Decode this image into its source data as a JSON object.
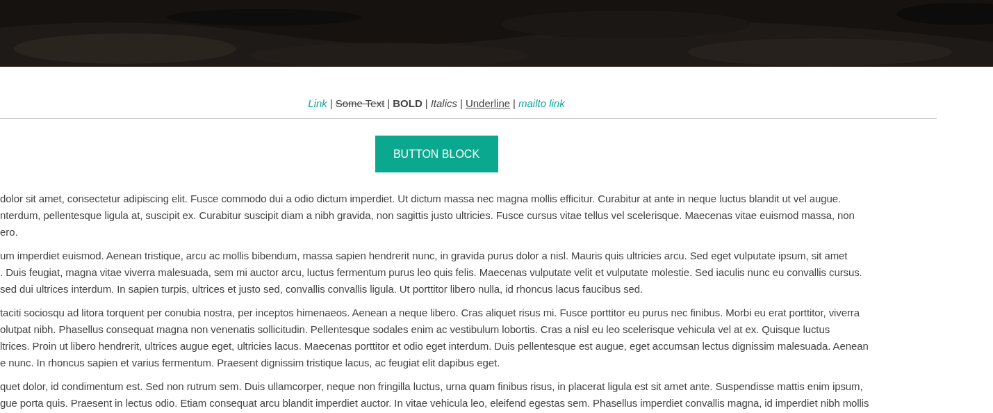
{
  "format_line": [
    {
      "kind": "link",
      "text": "Link"
    },
    {
      "kind": "separator",
      "text": "|"
    },
    {
      "kind": "strike",
      "text": "Some Text"
    },
    {
      "kind": "separator",
      "text": "|"
    },
    {
      "kind": "bold",
      "text": "BOLD"
    },
    {
      "kind": "separator",
      "text": "|"
    },
    {
      "kind": "italic",
      "text": "Italics"
    },
    {
      "kind": "separator",
      "text": "|"
    },
    {
      "kind": "underline",
      "text": "Underline"
    },
    {
      "kind": "separator",
      "text": "|"
    },
    {
      "kind": "link",
      "text": "mailto link"
    }
  ],
  "button": {
    "label": "BUTTON BLOCK"
  },
  "paragraphs": [
    {
      "lines": [
        "dolor sit amet, consectetur adipiscing elit. Fusce commodo dui a odio dictum imperdiet. Ut dictum massa nec magna mollis efficitur. Curabitur at ante in neque luctus blandit ut vel augue.",
        "nterdum, pellentesque ligula at, suscipit ex. Curabitur suscipit diam a nibh gravida, non sagittis justo ultricies. Fusce cursus vitae tellus vel scelerisque. Maecenas vitae euismod massa, non",
        "ero."
      ]
    },
    {
      "lines": [
        "um imperdiet euismod. Aenean tristique, arcu ac mollis bibendum, massa sapien hendrerit nunc, in gravida purus dolor a nisl. Mauris quis ultricies arcu. Sed eget vulputate ipsum, sit amet",
        ". Duis feugiat, magna vitae viverra malesuada, sem mi auctor arcu, luctus fermentum purus leo quis felis. Maecenas vulputate velit et vulputate molestie. Sed iaculis nunc eu convallis cursus.",
        "sed dui ultrices interdum. In sapien turpis, ultrices et justo sed, convallis convallis ligula. Ut porttitor libero nulla, id rhoncus lacus faucibus sed."
      ]
    },
    {
      "lines": [
        "taciti sociosqu ad litora torquent per conubia nostra, per inceptos himenaeos. Aenean a neque libero. Cras aliquet risus mi. Fusce porttitor eu purus nec finibus. Morbi eu erat porttitor, viverra",
        "olutpat nibh. Phasellus consequat magna non venenatis sollicitudin. Pellentesque sodales enim ac vestibulum lobortis. Cras a nisl eu leo scelerisque vehicula vel at ex. Quisque luctus",
        "ltrices. Proin ut libero hendrerit, ultrices augue eget, ultricies lacus. Maecenas porttitor et odio eget interdum. Duis pellentesque est augue, eget accumsan lectus dignissim malesuada. Aenean",
        "e nunc. In rhoncus sapien et varius fermentum. Praesent dignissim tristique lacus, ac feugiat elit dapibus eget."
      ]
    },
    {
      "lines": [
        "quet dolor, id condimentum est. Sed non rutrum sem. Duis ullamcorper, neque non fringilla luctus, urna quam finibus risus, in placerat ligula est sit amet ante. Suspendisse mattis enim ipsum,",
        "gue porta quis. Praesent in lectus odio. Etiam consequat arcu blandit imperdiet auctor. In vitae vehicula leo, eleifend egestas sem. Phasellus imperdiet convallis magna, id imperdiet nibh mollis"
      ]
    }
  ]
}
